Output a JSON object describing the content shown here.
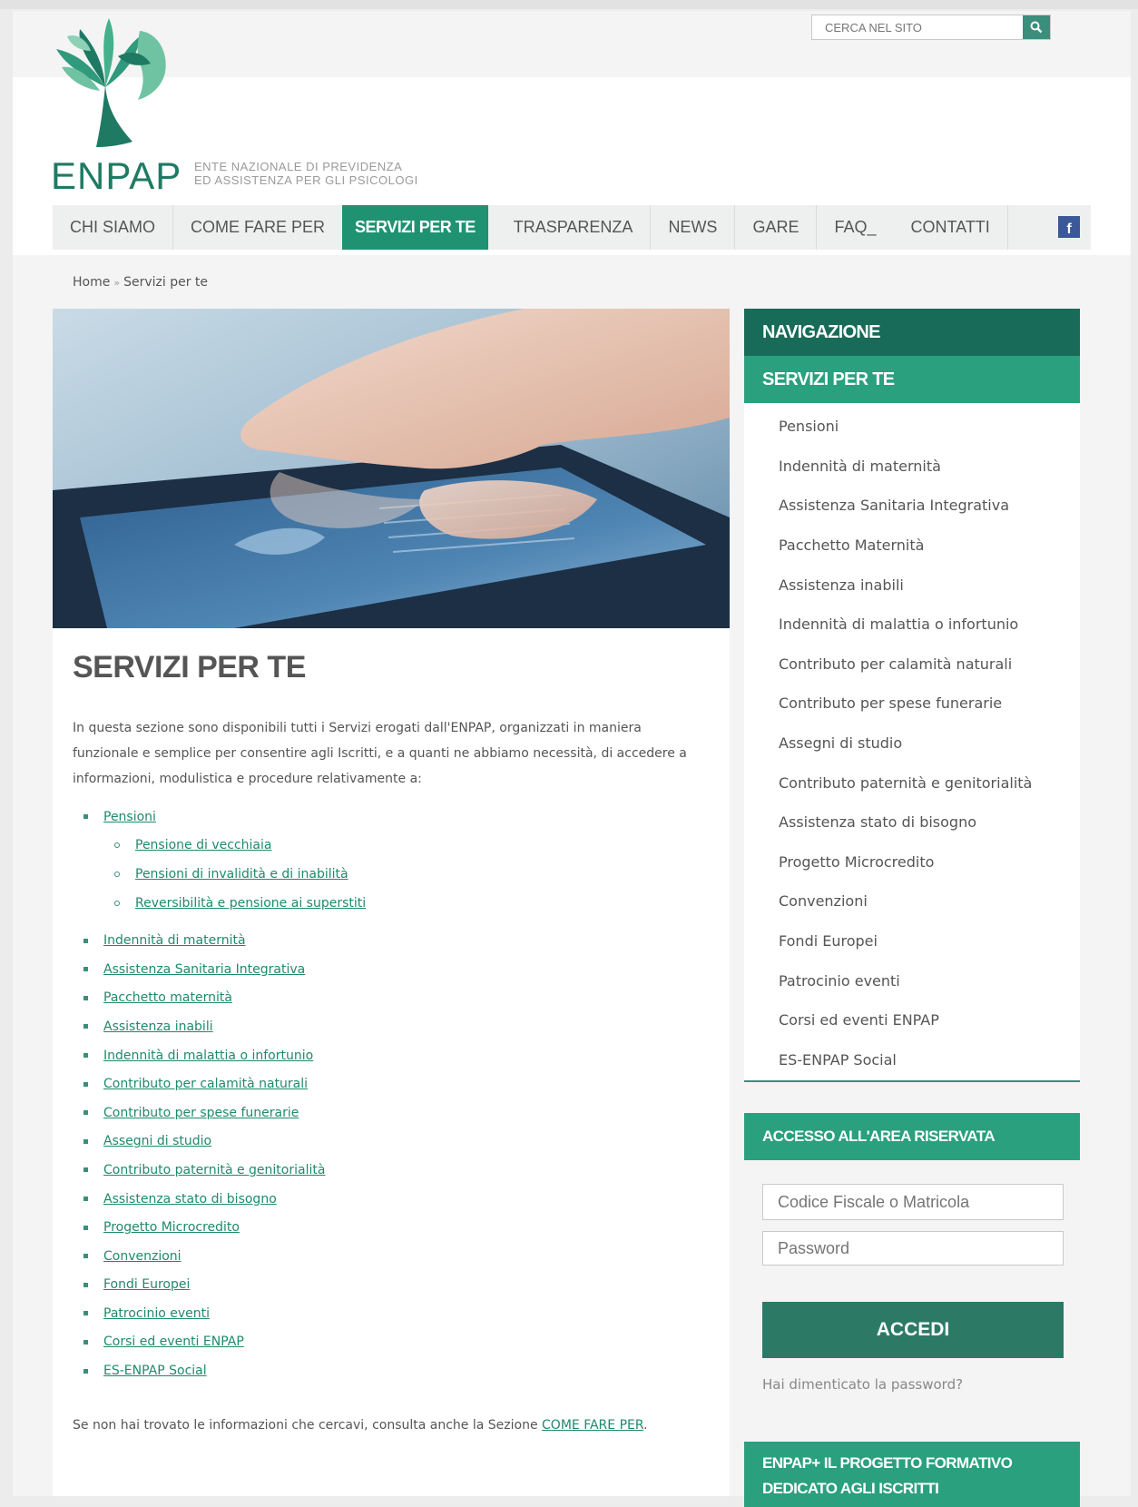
{
  "site": {
    "logo_text": "ENPAP",
    "logo_subtitle_line1": "ENTE NAZIONALE DI PREVIDENZA",
    "logo_subtitle_line2": "ED ASSISTENZA PER GLI PSICOLOGI",
    "brand_color": "#1f9272",
    "dark_color": "#176b58"
  },
  "search": {
    "placeholder": "CERCA NEL SITO",
    "icon": "search-icon"
  },
  "nav": {
    "items": [
      {
        "label": "CHI SIAMO"
      },
      {
        "label": "COME FARE PER"
      },
      {
        "label": "SERVIZI PER TE",
        "active": true
      },
      {
        "label": "TRASPARENZA"
      },
      {
        "label": "NEWS"
      },
      {
        "label": "GARE"
      },
      {
        "label": "FAQ_"
      },
      {
        "label": "CONTATTI"
      }
    ],
    "social_icon": "facebook-icon",
    "social_label": "f"
  },
  "breadcrumb": {
    "home": "Home",
    "separator": "»",
    "current": "Servizi per te"
  },
  "main": {
    "title": "SERVIZI PER TE",
    "intro": "In questa sezione sono disponibili tutti i Servizi erogati dall'ENPAP, organizzati in maniera funzionale e semplice per consentire agli Iscritti, e a quanti ne abbiamo necessità, di accedere a informazioni, modulistica e procedure relativamente a:",
    "services": [
      {
        "label": "Pensioni",
        "children": [
          "Pensione di vecchiaia",
          "Pensioni di invalidità e di inabilità",
          "Reversibilità e pensione ai superstiti"
        ]
      },
      {
        "label": "Indennità di maternità"
      },
      {
        "label": "Assistenza Sanitaria Integrativa"
      },
      {
        "label": "Pacchetto maternità"
      },
      {
        "label": "Assistenza inabili"
      },
      {
        "label": "Indennità di malattia o infortunio"
      },
      {
        "label": "Contributo per calamità naturali"
      },
      {
        "label": "Contributo per spese funerarie"
      },
      {
        "label": "Assegni di studio"
      },
      {
        "label": "Contributo paternità e genitorialità"
      },
      {
        "label": "Assistenza stato di bisogno"
      },
      {
        "label": "Progetto Microcredito"
      },
      {
        "label": "Convenzioni"
      },
      {
        "label": "Fondi Europei"
      },
      {
        "label": "Patrocinio eventi"
      },
      {
        "label": "Corsi ed eventi ENPAP"
      },
      {
        "label": "ES-ENPAP Social"
      }
    ],
    "footer_text": "Se non hai trovato le informazioni che cercavi, consulta anche la Sezione ",
    "footer_link": "COME FARE PER",
    "footer_end": "."
  },
  "sidebar": {
    "nav_title": "NAVIGAZIONE",
    "section_title": "SERVIZI PER TE",
    "items": [
      "Pensioni",
      "Indennità di maternità",
      "Assistenza Sanitaria Integrativa",
      "Pacchetto Maternità",
      "Assistenza inabili",
      "Indennità di malattia o infortunio",
      "Contributo per calamità naturali",
      "Contributo per spese funerarie",
      "Assegni di studio",
      "Contributo paternità e genitorialità",
      "Assistenza stato di bisogno",
      "Progetto Microcredito",
      "Convenzioni",
      "Fondi Europei",
      "Patrocinio eventi",
      "Corsi ed eventi ENPAP",
      "ES-ENPAP Social"
    ],
    "login": {
      "title": "ACCESSO ALL'AREA RISERVATA",
      "username_placeholder": "Codice Fiscale o Matricola",
      "password_placeholder": "Password",
      "button": "ACCEDI",
      "forgot": "Hai dimenticato la password?"
    },
    "promo_line1": "ENPAP+ IL PROGETTO FORMATIVO",
    "promo_line2": "DEDICATO AGLI ISCRITTI"
  }
}
